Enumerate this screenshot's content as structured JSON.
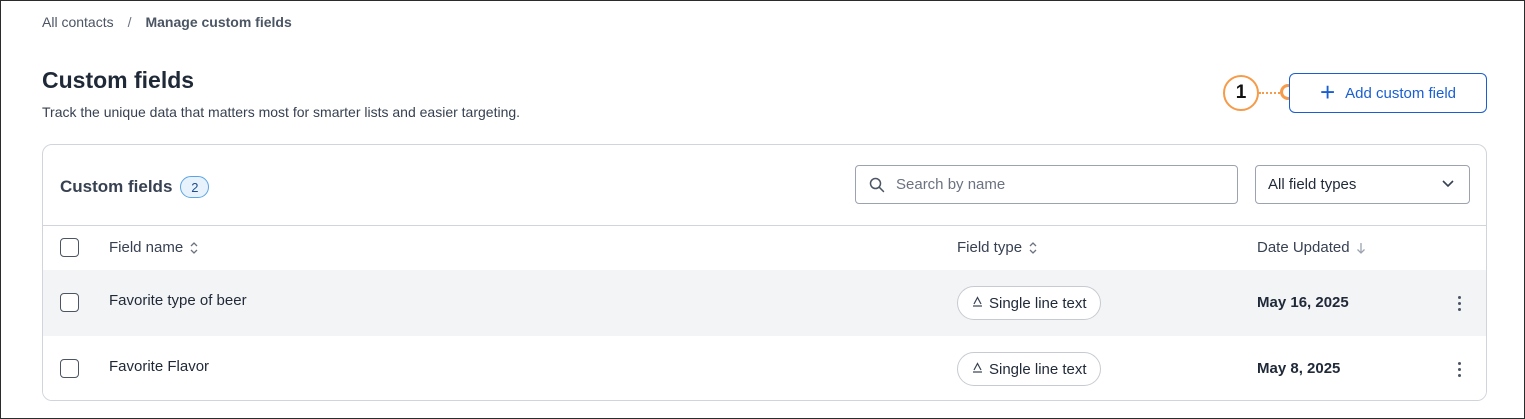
{
  "breadcrumb": {
    "parent_label": "All contacts",
    "separator": "/",
    "current_label": "Manage custom fields"
  },
  "header": {
    "title": "Custom fields",
    "subtitle": "Track the unique data that matters most for smarter lists and easier targeting."
  },
  "callout": {
    "number": "1",
    "color": "#f59b4a"
  },
  "add_button": {
    "icon": "plus-icon",
    "label": "Add custom field",
    "color": "#1a5fd1"
  },
  "card": {
    "title": "Custom fields",
    "count": "2",
    "search": {
      "placeholder": "Search by name",
      "value": "",
      "icon": "search-icon"
    },
    "filter": {
      "selected": "All field types",
      "icon": "chevron-down-icon"
    }
  },
  "table": {
    "columns": {
      "name": "Field name",
      "type": "Field type",
      "date": "Date Updated"
    },
    "rows": [
      {
        "name": "Favorite type of beer",
        "type": "Single line text",
        "type_icon": "text-type-icon",
        "date": "May 16, 2025"
      },
      {
        "name": "Favorite Flavor",
        "type": "Single line text",
        "type_icon": "text-type-icon",
        "date": "May 8, 2025"
      }
    ]
  }
}
